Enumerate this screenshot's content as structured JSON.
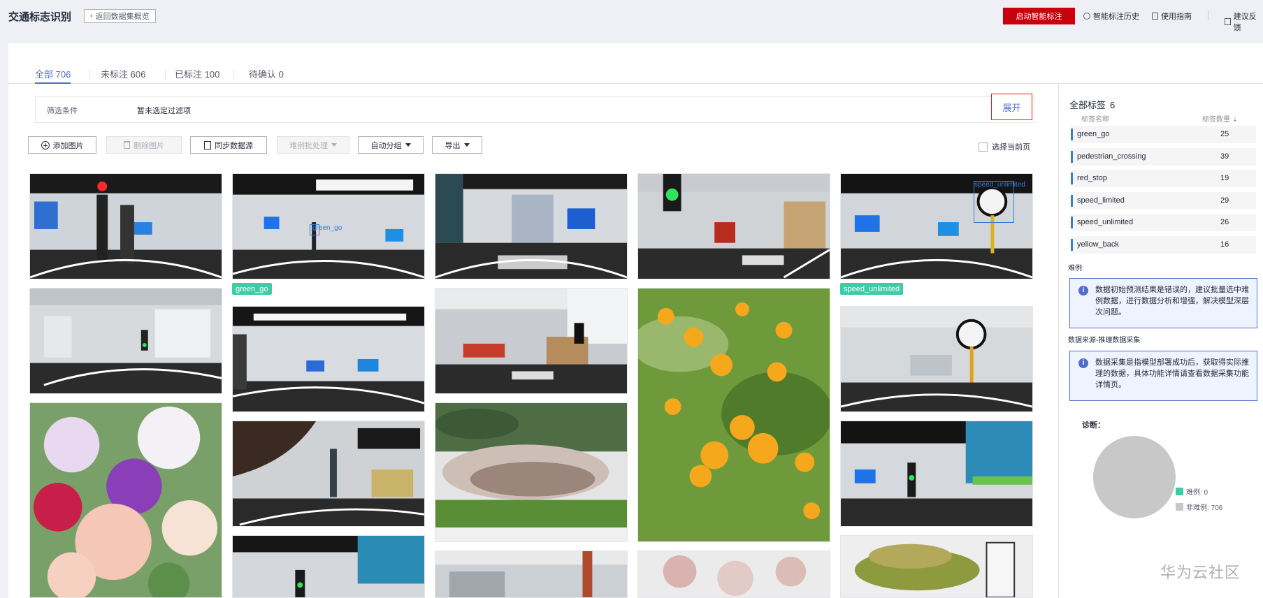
{
  "header": {
    "title": "交通标志识别",
    "back_label": "返回数据集概览",
    "start_label": "启动智能标注",
    "links": [
      "智能标注历史",
      "使用指南",
      "建议反馈"
    ]
  },
  "tabs": [
    {
      "label": "全部 706",
      "active": true
    },
    {
      "label": "未标注 606",
      "active": false
    },
    {
      "label": "已标注 100",
      "active": false
    },
    {
      "label": "待确认 0",
      "active": false
    }
  ],
  "filter": {
    "label": "筛选条件",
    "value": "暂未选定过滤项",
    "expand_label": "展开"
  },
  "toolbar": {
    "add": "添加图片",
    "delete": "删除图片",
    "sync": "同步数据源",
    "batch": "难例批处理",
    "group": "自动分组",
    "export": "导出",
    "select_page": "选择当前页"
  },
  "image_tags": {
    "green_go": "green_go",
    "speed_unlimited": "speed_unlimited"
  },
  "bbox_labels": {
    "green_go": "green_go",
    "speed_unlimited": "speed_unlimited"
  },
  "sidebar": {
    "title": "全部标签",
    "count": "6",
    "col_name": "标签名称",
    "col_count": "标签数量",
    "labels": [
      {
        "name": "green_go",
        "count": "25"
      },
      {
        "name": "pedestrian_crossing",
        "count": "39"
      },
      {
        "name": "red_stop",
        "count": "19"
      },
      {
        "name": "speed_limited",
        "count": "29"
      },
      {
        "name": "speed_unlimited",
        "count": "26"
      },
      {
        "name": "yellow_back",
        "count": "16"
      }
    ],
    "hard_label": "难例:",
    "hard_info": "数据初始预测结果是错误的，建议批量选中难例数据，进行数据分析和增强，解决模型深层次问题。",
    "source_label": "数据来源-推理数据采集:",
    "source_info": "数据采集是指模型部署成功后，获取得实际推理的数据，具体功能详情请查看数据采集功能详情页。",
    "diag_label": "诊断：",
    "legend": [
      {
        "label": "难例: 0",
        "color": "#3dcca6"
      },
      {
        "label": "非难例: 706",
        "color": "#c8c8c8"
      }
    ]
  },
  "watermark": "华为云社区"
}
